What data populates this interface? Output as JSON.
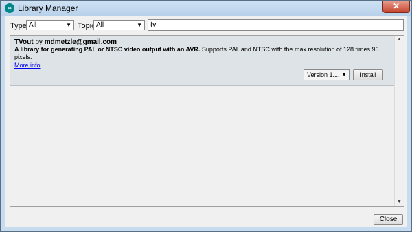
{
  "window": {
    "title": "Library Manager",
    "logo_text": "∞",
    "close_glyph": "✕"
  },
  "filters": {
    "type_label": "Type",
    "type_value": "All",
    "topic_label": "Topic",
    "topic_value": "All",
    "search_value": "tv"
  },
  "libraries": [
    {
      "name": "TVout",
      "by": "by",
      "author": "mdmetzle@gmail.com",
      "summary": "A library for generating PAL or NTSC video output with an AVR.",
      "details": "Supports PAL and NTSC with the max resolution of 128 times 96 pixels.",
      "more_info": "More info",
      "version_value": "Version 1....",
      "install_label": "Install"
    }
  ],
  "footer": {
    "close_label": "Close"
  },
  "icons": {
    "dropdown": "chevron-down-icon",
    "scroll_up": "scroll-up-arrow-icon",
    "scroll_down": "scroll-down-arrow-icon"
  },
  "colors": {
    "entry_bg": "#dde3e6",
    "link": "#0000ee",
    "titlebar": "#c7dcee",
    "close_red": "#c7432c"
  }
}
